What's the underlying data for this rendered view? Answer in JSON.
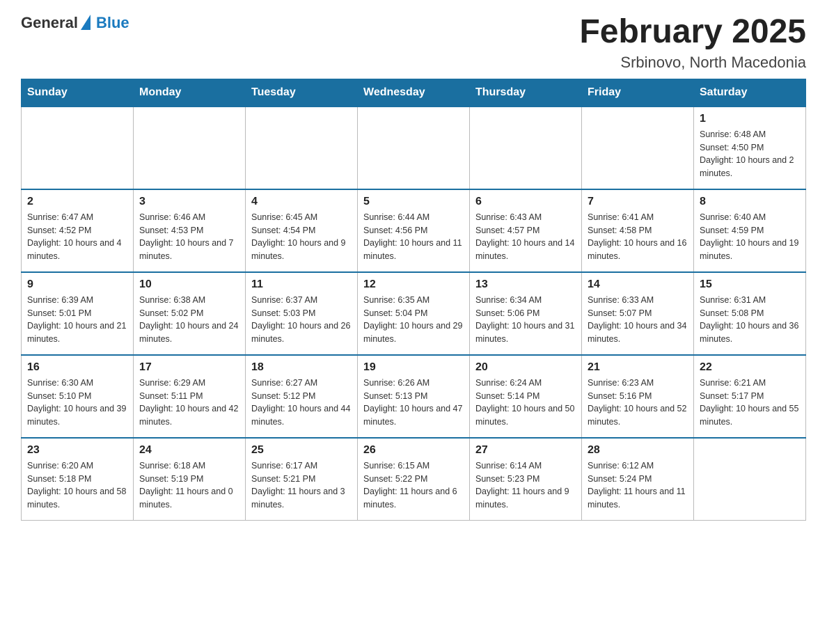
{
  "header": {
    "logo_general": "General",
    "logo_blue": "Blue",
    "title": "February 2025",
    "subtitle": "Srbinovo, North Macedonia"
  },
  "days_of_week": [
    "Sunday",
    "Monday",
    "Tuesday",
    "Wednesday",
    "Thursday",
    "Friday",
    "Saturday"
  ],
  "weeks": [
    [
      {
        "day": "",
        "sunrise": "",
        "sunset": "",
        "daylight": ""
      },
      {
        "day": "",
        "sunrise": "",
        "sunset": "",
        "daylight": ""
      },
      {
        "day": "",
        "sunrise": "",
        "sunset": "",
        "daylight": ""
      },
      {
        "day": "",
        "sunrise": "",
        "sunset": "",
        "daylight": ""
      },
      {
        "day": "",
        "sunrise": "",
        "sunset": "",
        "daylight": ""
      },
      {
        "day": "",
        "sunrise": "",
        "sunset": "",
        "daylight": ""
      },
      {
        "day": "1",
        "sunrise": "Sunrise: 6:48 AM",
        "sunset": "Sunset: 4:50 PM",
        "daylight": "Daylight: 10 hours and 2 minutes."
      }
    ],
    [
      {
        "day": "2",
        "sunrise": "Sunrise: 6:47 AM",
        "sunset": "Sunset: 4:52 PM",
        "daylight": "Daylight: 10 hours and 4 minutes."
      },
      {
        "day": "3",
        "sunrise": "Sunrise: 6:46 AM",
        "sunset": "Sunset: 4:53 PM",
        "daylight": "Daylight: 10 hours and 7 minutes."
      },
      {
        "day": "4",
        "sunrise": "Sunrise: 6:45 AM",
        "sunset": "Sunset: 4:54 PM",
        "daylight": "Daylight: 10 hours and 9 minutes."
      },
      {
        "day": "5",
        "sunrise": "Sunrise: 6:44 AM",
        "sunset": "Sunset: 4:56 PM",
        "daylight": "Daylight: 10 hours and 11 minutes."
      },
      {
        "day": "6",
        "sunrise": "Sunrise: 6:43 AM",
        "sunset": "Sunset: 4:57 PM",
        "daylight": "Daylight: 10 hours and 14 minutes."
      },
      {
        "day": "7",
        "sunrise": "Sunrise: 6:41 AM",
        "sunset": "Sunset: 4:58 PM",
        "daylight": "Daylight: 10 hours and 16 minutes."
      },
      {
        "day": "8",
        "sunrise": "Sunrise: 6:40 AM",
        "sunset": "Sunset: 4:59 PM",
        "daylight": "Daylight: 10 hours and 19 minutes."
      }
    ],
    [
      {
        "day": "9",
        "sunrise": "Sunrise: 6:39 AM",
        "sunset": "Sunset: 5:01 PM",
        "daylight": "Daylight: 10 hours and 21 minutes."
      },
      {
        "day": "10",
        "sunrise": "Sunrise: 6:38 AM",
        "sunset": "Sunset: 5:02 PM",
        "daylight": "Daylight: 10 hours and 24 minutes."
      },
      {
        "day": "11",
        "sunrise": "Sunrise: 6:37 AM",
        "sunset": "Sunset: 5:03 PM",
        "daylight": "Daylight: 10 hours and 26 minutes."
      },
      {
        "day": "12",
        "sunrise": "Sunrise: 6:35 AM",
        "sunset": "Sunset: 5:04 PM",
        "daylight": "Daylight: 10 hours and 29 minutes."
      },
      {
        "day": "13",
        "sunrise": "Sunrise: 6:34 AM",
        "sunset": "Sunset: 5:06 PM",
        "daylight": "Daylight: 10 hours and 31 minutes."
      },
      {
        "day": "14",
        "sunrise": "Sunrise: 6:33 AM",
        "sunset": "Sunset: 5:07 PM",
        "daylight": "Daylight: 10 hours and 34 minutes."
      },
      {
        "day": "15",
        "sunrise": "Sunrise: 6:31 AM",
        "sunset": "Sunset: 5:08 PM",
        "daylight": "Daylight: 10 hours and 36 minutes."
      }
    ],
    [
      {
        "day": "16",
        "sunrise": "Sunrise: 6:30 AM",
        "sunset": "Sunset: 5:10 PM",
        "daylight": "Daylight: 10 hours and 39 minutes."
      },
      {
        "day": "17",
        "sunrise": "Sunrise: 6:29 AM",
        "sunset": "Sunset: 5:11 PM",
        "daylight": "Daylight: 10 hours and 42 minutes."
      },
      {
        "day": "18",
        "sunrise": "Sunrise: 6:27 AM",
        "sunset": "Sunset: 5:12 PM",
        "daylight": "Daylight: 10 hours and 44 minutes."
      },
      {
        "day": "19",
        "sunrise": "Sunrise: 6:26 AM",
        "sunset": "Sunset: 5:13 PM",
        "daylight": "Daylight: 10 hours and 47 minutes."
      },
      {
        "day": "20",
        "sunrise": "Sunrise: 6:24 AM",
        "sunset": "Sunset: 5:14 PM",
        "daylight": "Daylight: 10 hours and 50 minutes."
      },
      {
        "day": "21",
        "sunrise": "Sunrise: 6:23 AM",
        "sunset": "Sunset: 5:16 PM",
        "daylight": "Daylight: 10 hours and 52 minutes."
      },
      {
        "day": "22",
        "sunrise": "Sunrise: 6:21 AM",
        "sunset": "Sunset: 5:17 PM",
        "daylight": "Daylight: 10 hours and 55 minutes."
      }
    ],
    [
      {
        "day": "23",
        "sunrise": "Sunrise: 6:20 AM",
        "sunset": "Sunset: 5:18 PM",
        "daylight": "Daylight: 10 hours and 58 minutes."
      },
      {
        "day": "24",
        "sunrise": "Sunrise: 6:18 AM",
        "sunset": "Sunset: 5:19 PM",
        "daylight": "Daylight: 11 hours and 0 minutes."
      },
      {
        "day": "25",
        "sunrise": "Sunrise: 6:17 AM",
        "sunset": "Sunset: 5:21 PM",
        "daylight": "Daylight: 11 hours and 3 minutes."
      },
      {
        "day": "26",
        "sunrise": "Sunrise: 6:15 AM",
        "sunset": "Sunset: 5:22 PM",
        "daylight": "Daylight: 11 hours and 6 minutes."
      },
      {
        "day": "27",
        "sunrise": "Sunrise: 6:14 AM",
        "sunset": "Sunset: 5:23 PM",
        "daylight": "Daylight: 11 hours and 9 minutes."
      },
      {
        "day": "28",
        "sunrise": "Sunrise: 6:12 AM",
        "sunset": "Sunset: 5:24 PM",
        "daylight": "Daylight: 11 hours and 11 minutes."
      },
      {
        "day": "",
        "sunrise": "",
        "sunset": "",
        "daylight": ""
      }
    ]
  ]
}
